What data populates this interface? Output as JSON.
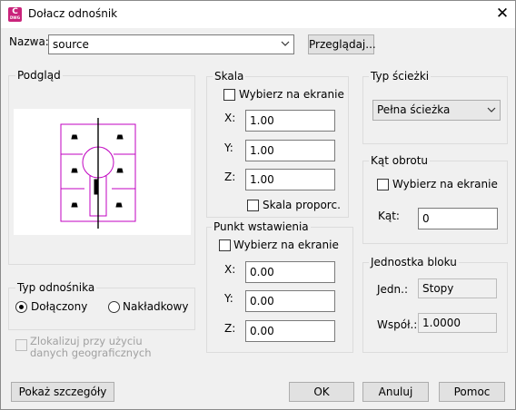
{
  "window": {
    "title": "Dołacz odnośnik",
    "app_icon_letter": "C",
    "app_icon_sub": "DWG",
    "close_glyph": "✕"
  },
  "name_row": {
    "label": "Nazwa:",
    "value": "source",
    "browse_button": "Przeglądaj..."
  },
  "preview": {
    "title": "Podgląd"
  },
  "scale": {
    "title": "Skala",
    "specify_on_screen": "Wybierz na ekranie",
    "x_label": "X:",
    "x_value": "1.00",
    "y_label": "Y:",
    "y_value": "1.00",
    "z_label": "Z:",
    "z_value": "1.00",
    "uniform": "Skala proporc."
  },
  "path_type": {
    "title": "Typ ścieżki",
    "selected": "Pełna ścieżka"
  },
  "rotation": {
    "title": "Kąt obrotu",
    "specify_on_screen": "Wybierz na ekranie",
    "angle_label": "Kąt:",
    "angle_value": "0"
  },
  "insertion_point": {
    "title": "Punkt wstawienia",
    "specify_on_screen": "Wybierz na ekranie",
    "x_label": "X:",
    "x_value": "0.00",
    "y_label": "Y:",
    "y_value": "0.00",
    "z_label": "Z:",
    "z_value": "0.00"
  },
  "block_unit": {
    "title": "Jednostka bloku",
    "unit_label": "Jedn.:",
    "unit_value": "Stopy",
    "factor_label": "Współ.:",
    "factor_value": "1.0000"
  },
  "reference_type": {
    "title": "Typ odnośnika",
    "attached": "Dołączony",
    "overlay": "Nakładkowy",
    "selected": "attached"
  },
  "locate_geo": "Zlokalizuj przy użyciu danych geograficznych",
  "buttons": {
    "details": "Pokaż szczegóły",
    "ok": "OK",
    "cancel": "Anuluj",
    "help": "Pomoc"
  },
  "colors": {
    "preview_lines": "#c000c0",
    "app_icon": "#c9237b"
  }
}
